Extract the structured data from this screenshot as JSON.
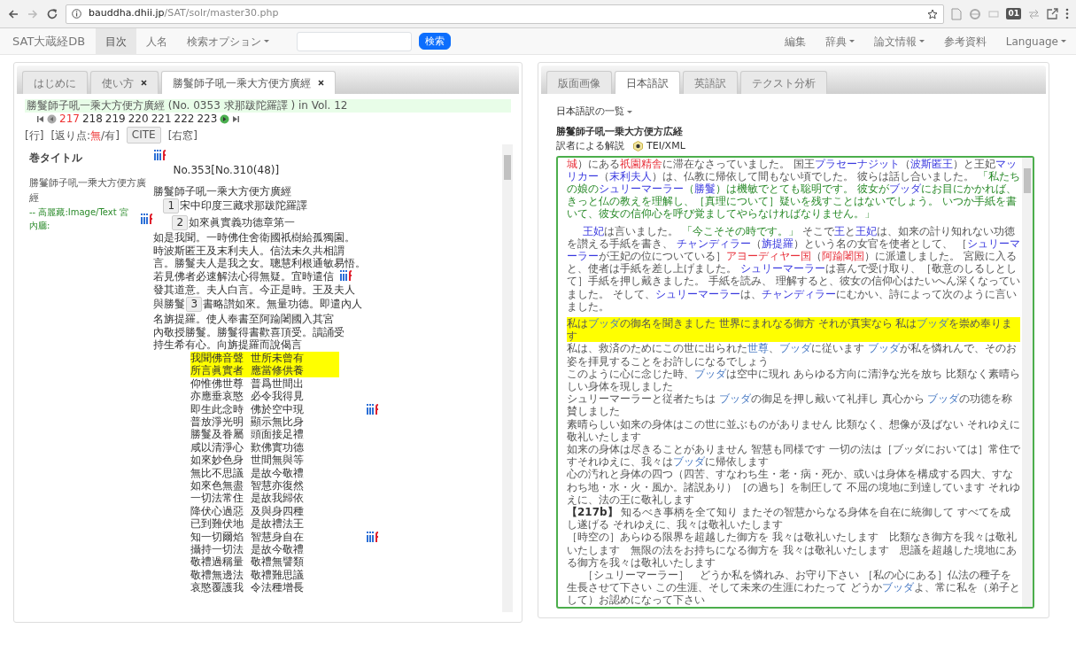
{
  "browser": {
    "url_host": "bauddha.dhii.jp",
    "url_path": "/SAT/solr/master30.php",
    "extension_badge": "01"
  },
  "navbar": {
    "brand": "SAT大蔵経DB",
    "items": [
      {
        "label": "目次",
        "selected": true,
        "dropdown": false
      },
      {
        "label": "人名",
        "selected": false,
        "dropdown": false
      },
      {
        "label": "検索オプション",
        "selected": false,
        "dropdown": true
      }
    ],
    "search_button": "検索",
    "right_items": [
      {
        "label": "編集",
        "dropdown": false
      },
      {
        "label": "辞典",
        "dropdown": true
      },
      {
        "label": "論文情報",
        "dropdown": true
      },
      {
        "label": "参考資料",
        "dropdown": false
      },
      {
        "label": "Language",
        "dropdown": true
      }
    ]
  },
  "left_panel": {
    "tabs": [
      {
        "label": "はじめに",
        "selected": false,
        "closable": false
      },
      {
        "label": "使い方",
        "selected": false,
        "closable": true
      },
      {
        "label": "勝鬘師子吼一乘大方便方廣經",
        "selected": true,
        "closable": true
      }
    ],
    "header": "勝鬘師子吼一乘大方便方廣經 (No. 0353 求那跋陀羅譯 ) in Vol. 12",
    "pages": [
      {
        "label": "217",
        "selected": true
      },
      {
        "label": "218",
        "selected": false
      },
      {
        "label": "219",
        "selected": false
      },
      {
        "label": "220",
        "selected": false
      },
      {
        "label": "221",
        "selected": false
      },
      {
        "label": "222",
        "selected": false
      },
      {
        "label": "223",
        "selected": false
      }
    ],
    "line_link": "[行]",
    "kaeriten": {
      "prefix": "[返り点:",
      "options": [
        {
          "label": "無",
          "selected": true
        },
        {
          "label": "有",
          "selected": false
        }
      ],
      "separator": "/",
      "suffix": "]"
    },
    "cite_button": "CITE",
    "right_window_link": "[右窓]",
    "sidebar": {
      "heading": "巻タイトル",
      "title": "勝鬘師子吼一乘大方便方廣經",
      "sources": "-- 高麗藏:Image/Text 宮內廳:"
    },
    "lines": [
      {
        "kind": "iiif"
      },
      {
        "kind": "number",
        "before": "No.353[No.310(48)]"
      },
      {
        "kind": "gap"
      },
      {
        "kind": "prose",
        "before": "勝鬘師子吼一乘大方便方廣經",
        "iiif": false
      },
      {
        "kind": "translator",
        "marker": "1",
        "after": "宋中印度三藏求那跋陀羅譯",
        "iiif": false
      },
      {
        "kind": "chapter",
        "marker": "2",
        "after": "如來眞實義功德章第一",
        "iiif": false
      },
      {
        "kind": "prose",
        "before": "如是我聞。一時佛住舍衛國祇樹給孤獨園。",
        "iiif": false
      },
      {
        "kind": "prose",
        "before": "時波斯匿王及末利夫人。信法未久共相謂",
        "iiif": false
      },
      {
        "kind": "prose",
        "before": "言。勝鬘夫人是我之女。聰慧利根通敏易悟。",
        "iiif": false
      },
      {
        "kind": "prose",
        "before": "若見佛者必速解法心得無疑。宜時遣信",
        "iiif": true
      },
      {
        "kind": "prose",
        "before": "發其道意。夫人白言。今正是時。王及夫人",
        "iiif": false
      },
      {
        "kind": "prose",
        "before": "與勝鬘",
        "marker": "3",
        "after": "書略讃如來。無量功德。即遣內人",
        "iiif": false
      },
      {
        "kind": "prose",
        "before": "名旃提羅。使人奉書至阿踰闍國入其宮",
        "iiif": false
      },
      {
        "kind": "prose",
        "before": "內敬授勝鬘。勝鬘得書歡喜頂受。讀誦受",
        "iiif": false
      },
      {
        "kind": "prose",
        "before": "持生希有心。向旃提羅而說偈言",
        "iiif": false
      },
      {
        "kind": "verse",
        "halves": [
          "我聞佛音聲",
          "世所未曾有"
        ],
        "highlighted": true,
        "iiif": false
      },
      {
        "kind": "verse",
        "halves": [
          "所言眞實者",
          "應當修供養"
        ],
        "highlighted": true,
        "iiif": false
      },
      {
        "kind": "verse",
        "halves": [
          "仰惟佛世尊",
          "普爲世間出"
        ],
        "highlighted": false,
        "iiif": false
      },
      {
        "kind": "verse",
        "halves": [
          "亦應垂哀愍",
          "必令我得見"
        ],
        "highlighted": false,
        "iiif": false
      },
      {
        "kind": "verse",
        "halves": [
          "即生此念時",
          "佛於空中現"
        ],
        "highlighted": false,
        "iiif": true
      },
      {
        "kind": "verse",
        "halves": [
          "普放淨光明",
          "顯示無比身"
        ],
        "highlighted": false,
        "iiif": false
      },
      {
        "kind": "verse",
        "halves": [
          "勝鬘及眷屬",
          "頭面接足禮"
        ],
        "highlighted": false,
        "iiif": false
      },
      {
        "kind": "verse",
        "halves": [
          "咸以清淨心",
          "歎佛實功德"
        ],
        "highlighted": false,
        "iiif": false
      },
      {
        "kind": "verse",
        "halves": [
          "如來妙色身",
          "世間無與等"
        ],
        "highlighted": false,
        "iiif": false
      },
      {
        "kind": "verse",
        "halves": [
          "無比不思議",
          "是故今敬禮"
        ],
        "highlighted": false,
        "iiif": false
      },
      {
        "kind": "verse",
        "halves": [
          "如來色無盡",
          "智慧亦復然"
        ],
        "highlighted": false,
        "iiif": false
      },
      {
        "kind": "verse",
        "halves": [
          "一切法常住",
          "是故我歸依"
        ],
        "highlighted": false,
        "iiif": false
      },
      {
        "kind": "verse",
        "halves": [
          "降伏心過惡",
          "及與身四種"
        ],
        "highlighted": false,
        "iiif": false
      },
      {
        "kind": "verse",
        "halves": [
          "已到難伏地",
          "是故禮法王"
        ],
        "highlighted": false,
        "iiif": false
      },
      {
        "kind": "verse",
        "halves": [
          "知一切爾焰",
          "智慧身自在"
        ],
        "highlighted": false,
        "iiif": true
      },
      {
        "kind": "verse",
        "halves": [
          "攝持一切法",
          "是故今敬禮"
        ],
        "highlighted": false,
        "iiif": false
      },
      {
        "kind": "verse",
        "halves": [
          "敬禮過稱量",
          "敬禮無譬類"
        ],
        "highlighted": false,
        "iiif": false
      },
      {
        "kind": "verse",
        "halves": [
          "敬禮無邊法",
          "敬禮難思議"
        ],
        "highlighted": false,
        "iiif": false
      },
      {
        "kind": "verse",
        "halves": [
          "哀愍覆護我",
          "令法種增長"
        ],
        "highlighted": false,
        "iiif": false
      }
    ]
  },
  "right_panel": {
    "tabs": [
      {
        "label": "版面画像",
        "selected": false
      },
      {
        "label": "日本語訳",
        "selected": true
      },
      {
        "label": "英語訳",
        "selected": false
      },
      {
        "label": "テクスト分析",
        "selected": false
      }
    ],
    "translations_menu": "日本語訳の一覧",
    "title": "勝鬘師子吼一乗大方便方広経",
    "commentary": "訳者による解説",
    "tei_link": "TEI/XML",
    "paragraphs": [
      {
        "kind": "prose",
        "indent": false,
        "highlight": false,
        "segments": [
          {
            "text": "城",
            "kind": "place"
          },
          {
            "text": "）にある",
            "kind": "text"
          },
          {
            "text": "祇園精舎",
            "kind": "place"
          },
          {
            "text": "に滞在なさっていました。 国王",
            "kind": "text"
          },
          {
            "text": "プラセーナジット",
            "kind": "name"
          },
          {
            "text": "（",
            "kind": "text"
          },
          {
            "text": "波斯匿王",
            "kind": "name"
          },
          {
            "text": "）と王妃",
            "kind": "text"
          },
          {
            "text": "マッリカー",
            "kind": "name"
          },
          {
            "text": "（",
            "kind": "text"
          },
          {
            "text": "末利夫人",
            "kind": "name"
          },
          {
            "text": "）は、仏教に帰依して間もない頃でした。 彼らは話し合いました。 ",
            "kind": "text"
          },
          {
            "text": "「私たちの娘の",
            "kind": "quote"
          },
          {
            "text": "シュリーマーラー",
            "kind": "name"
          },
          {
            "text": "（",
            "kind": "quote"
          },
          {
            "text": "勝鬘",
            "kind": "name"
          },
          {
            "text": "）は機敏でとても聡明です。 彼女が",
            "kind": "quote"
          },
          {
            "text": "ブッダ",
            "kind": "name"
          },
          {
            "text": "にお目にかかれば、きっと仏の教えを理解し、［真理について］疑いを残すことはないでしょう。 いつか手紙を書いて、彼女の信仰心を呼び覚ましてやらなければなりません。」",
            "kind": "quote"
          }
        ]
      },
      {
        "kind": "prose",
        "indent": true,
        "highlight": false,
        "segments": [
          {
            "text": "王妃",
            "kind": "name"
          },
          {
            "text": "は言いました。 ",
            "kind": "text"
          },
          {
            "text": "「今こそその時です。」",
            "kind": "quote"
          },
          {
            "text": " そこで",
            "kind": "text"
          },
          {
            "text": "王",
            "kind": "name"
          },
          {
            "text": "と",
            "kind": "text"
          },
          {
            "text": "王妃",
            "kind": "name"
          },
          {
            "text": "は、如来の計り知れない功徳を讃える手紙を書き、 ",
            "kind": "text"
          },
          {
            "text": "チャンディラー",
            "kind": "name"
          },
          {
            "text": "（",
            "kind": "text"
          },
          {
            "text": "旃提羅",
            "kind": "name"
          },
          {
            "text": "）という名の女官を使者として、 ［",
            "kind": "text"
          },
          {
            "text": "シュリーマーラー",
            "kind": "name"
          },
          {
            "text": "が王妃の位についている］",
            "kind": "text"
          },
          {
            "text": "アヨーディヤー国",
            "kind": "place"
          },
          {
            "text": "（",
            "kind": "text"
          },
          {
            "text": "阿踰闍国",
            "kind": "place"
          },
          {
            "text": "）に派遣しました。 宮殿に入ると、使者は手紙を差し上げました。 ",
            "kind": "text"
          },
          {
            "text": "シュリーマーラー",
            "kind": "name"
          },
          {
            "text": "は喜んで受け取り、［敬意のしるしとして］手紙を押し戴きました。 手紙を読み、 理解すると、彼女の信仰心はたいへん深くなっていました。 そして、",
            "kind": "text"
          },
          {
            "text": "シュリーマーラー",
            "kind": "name"
          },
          {
            "text": "は、",
            "kind": "text"
          },
          {
            "text": "チャンディラー",
            "kind": "name"
          },
          {
            "text": "にむかい、詩によって次のように言いました。",
            "kind": "text"
          }
        ]
      },
      {
        "kind": "verse",
        "indent": false,
        "highlight": true,
        "segments": [
          {
            "text": "私は",
            "kind": "text"
          },
          {
            "text": "ブッダ",
            "kind": "name"
          },
          {
            "text": "の御名を聞きました 世界にまれなる御方 それが真実なら 私は",
            "kind": "text"
          },
          {
            "text": "ブッダ",
            "kind": "name"
          },
          {
            "text": "を崇め奉ります",
            "kind": "text"
          }
        ]
      },
      {
        "kind": "verse",
        "indent": false,
        "highlight": false,
        "segments": [
          {
            "text": "私は、救済のためにこの世に出られた",
            "kind": "text"
          },
          {
            "text": "世尊",
            "kind": "name"
          },
          {
            "text": "、",
            "kind": "text"
          },
          {
            "text": "ブッダ",
            "kind": "name"
          },
          {
            "text": "に従います ",
            "kind": "text"
          },
          {
            "text": "ブッダ",
            "kind": "name"
          },
          {
            "text": "が私を憐れんで、そのお姿を拝見することをお許しになるでしょう",
            "kind": "text"
          }
        ]
      },
      {
        "kind": "verse",
        "indent": false,
        "highlight": false,
        "segments": [
          {
            "text": "このように心に念じた時、",
            "kind": "text"
          },
          {
            "text": "ブッダ",
            "kind": "name"
          },
          {
            "text": "は空中に現れ あらゆる方向に清浄な光を放ち 比類なく素晴らしい身体を現しました",
            "kind": "text"
          }
        ]
      },
      {
        "kind": "verse",
        "indent": false,
        "highlight": false,
        "segments": [
          {
            "text": "シュリーマーラーと従者たちは ",
            "kind": "text"
          },
          {
            "text": "ブッダ",
            "kind": "name"
          },
          {
            "text": "の御足を押し戴いて礼拝し 真心から ",
            "kind": "text"
          },
          {
            "text": "ブッダ",
            "kind": "name"
          },
          {
            "text": "の功徳を称賛しました",
            "kind": "text"
          }
        ]
      },
      {
        "kind": "verse",
        "indent": false,
        "highlight": false,
        "segments": [
          {
            "text": "素晴らしい如来の身体はこの世に並ぶものがありません 比類なく、想像が及ばない それゆえに敬礼いたします",
            "kind": "text"
          }
        ]
      },
      {
        "kind": "verse",
        "indent": false,
        "highlight": false,
        "segments": [
          {
            "text": "如来の身体は尽きることがありません 智慧も同様です 一切の法は［ブッダにおいては］常住ですそれゆえに、我々は",
            "kind": "text"
          },
          {
            "text": "ブッダ",
            "kind": "name"
          },
          {
            "text": "に帰依します",
            "kind": "text"
          }
        ]
      },
      {
        "kind": "verse",
        "indent": false,
        "highlight": false,
        "segments": [
          {
            "text": "心の汚れと身体の四つ（四苦、すなわち生・老・病・死か、或いは身体を構成する四大、すなわち地・水・火・風か。諸説あり）［の過ち］を制圧して 不屈の境地に到達しています それゆえに、法の王に敬礼します",
            "kind": "text"
          }
        ]
      },
      {
        "kind": "verse",
        "indent": false,
        "highlight": false,
        "segments": [
          {
            "text": "【217b】",
            "kind": "ref"
          },
          {
            "text": " 知るべき事柄を全て知り またその智慧からなる身体を自在に統御して すべてを成し遂げる それゆえに、我々は敬礼いたします",
            "kind": "text"
          }
        ]
      },
      {
        "kind": "verse",
        "indent": false,
        "highlight": false,
        "segments": [
          {
            "text": "［時空の］あらゆる限界を超越した御方を 我々は敬礼いたします　比類なき御方を我々は敬礼いたします　無限の法をお持ちになる御方を 我々は敬礼いたします　思議を超越した境地にある御方を我々は敬礼いたします",
            "kind": "text"
          }
        ]
      },
      {
        "kind": "verse",
        "indent": true,
        "highlight": false,
        "segments": [
          {
            "text": "［シュリーマーラー］　どうか私を憐れみ、お守り下さい ［私の心にある］仏法の種子を生長させて下さい この生涯、そして未来の生涯にわたって どうか",
            "kind": "text"
          },
          {
            "text": "ブッダ",
            "kind": "name"
          },
          {
            "text": "よ、常に私を（弟子として）お認めになって下さい",
            "kind": "text"
          }
        ]
      }
    ]
  }
}
